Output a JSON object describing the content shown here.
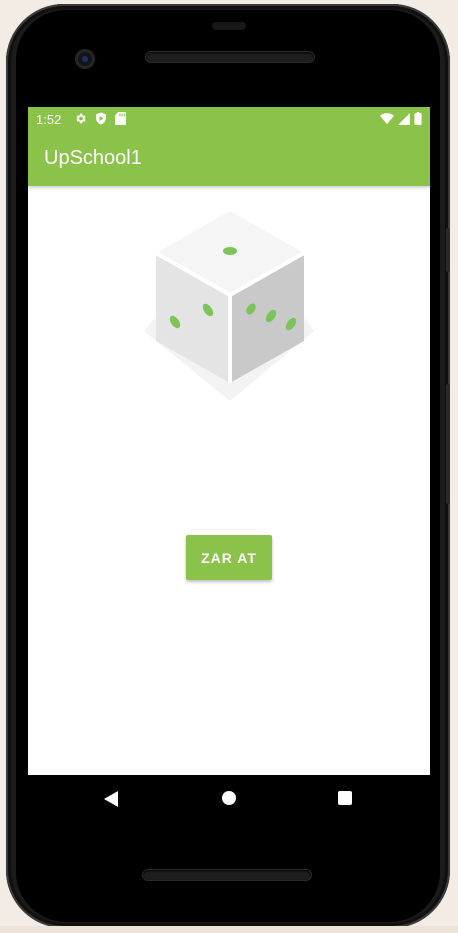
{
  "status_bar": {
    "time": "1:52",
    "left_icons": [
      "gear-icon",
      "shield-play-icon",
      "sd-card-icon"
    ],
    "right_icons": [
      "wifi-icon",
      "cellular-signal-icon",
      "battery-icon"
    ]
  },
  "app_bar": {
    "title": "UpSchool1",
    "color": "#8bc34a"
  },
  "main": {
    "dice_image": "dice-icon",
    "dice_pip_color": "#7cc35a",
    "roll_button_label": "ZAR AT"
  },
  "nav_bar": {
    "buttons": [
      "back-icon",
      "home-icon",
      "recents-icon"
    ]
  }
}
